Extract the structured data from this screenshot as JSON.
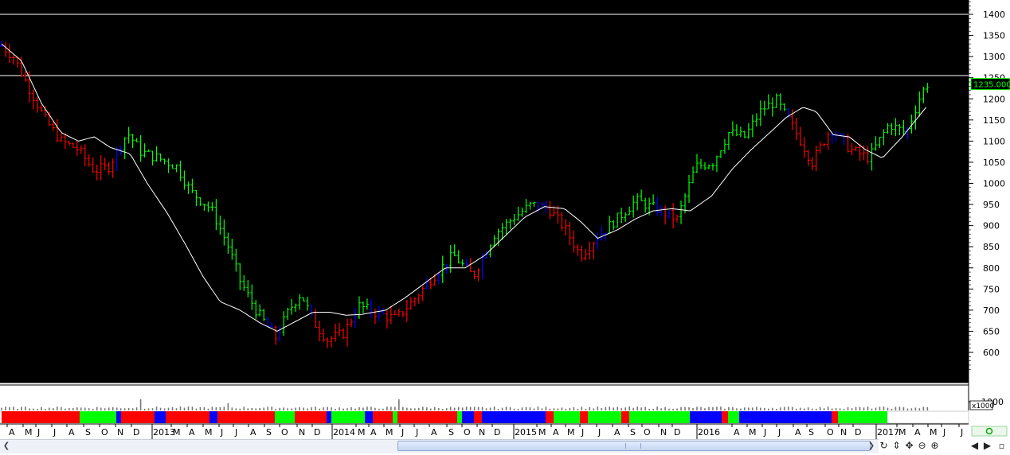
{
  "chart_data": {
    "type": "candlestick-bar",
    "y_ticks": [
      "1400",
      "1350",
      "1300",
      "1250",
      "1200",
      "1150",
      "1100",
      "1050",
      "1000",
      "950",
      "900",
      "850",
      "800",
      "750",
      "700",
      "650",
      "600"
    ],
    "ylim": [
      560,
      1430
    ],
    "last_price_label": "1235.000",
    "horizontal_lines": [
      1400,
      1255
    ],
    "volume_axis": {
      "tick": "1000",
      "multiplier": "x1000"
    },
    "x_labels": [
      "A",
      "M",
      "J",
      "J",
      "A",
      "S",
      "O",
      "N",
      "D",
      "2013",
      "M",
      "A",
      "M",
      "J",
      "J",
      "A",
      "S",
      "O",
      "N",
      "D",
      "2014",
      "M",
      "A",
      "M",
      "J",
      "J",
      "A",
      "S",
      "O",
      "N",
      "D",
      "2015",
      "M",
      "A",
      "M",
      "J",
      "J",
      "A",
      "S",
      "O",
      "N",
      "D",
      "2016",
      "A",
      "M",
      "J",
      "J",
      "A",
      "S",
      "O",
      "N",
      "D",
      "2017",
      "M",
      "A",
      "M",
      "J",
      "J"
    ],
    "price_path_anchors": [
      [
        0,
        1325
      ],
      [
        9,
        1300
      ],
      [
        20,
        1230
      ],
      [
        33,
        1150
      ],
      [
        45,
        1100
      ],
      [
        58,
        1080
      ],
      [
        70,
        1030
      ],
      [
        81,
        1040
      ],
      [
        95,
        1120
      ],
      [
        105,
        1075
      ],
      [
        118,
        1060
      ],
      [
        132,
        1040
      ],
      [
        143,
        980
      ],
      [
        158,
        940
      ],
      [
        170,
        860
      ],
      [
        180,
        770
      ],
      [
        192,
        700
      ],
      [
        207,
        635
      ],
      [
        217,
        700
      ],
      [
        226,
        740
      ],
      [
        236,
        670
      ],
      [
        246,
        630
      ],
      [
        258,
        645
      ],
      [
        270,
        710
      ],
      [
        286,
        690
      ],
      [
        298,
        680
      ],
      [
        310,
        720
      ],
      [
        326,
        780
      ],
      [
        341,
        830
      ],
      [
        356,
        780
      ],
      [
        372,
        880
      ],
      [
        387,
        920
      ],
      [
        400,
        950
      ],
      [
        413,
        940
      ],
      [
        425,
        895
      ],
      [
        437,
        830
      ],
      [
        452,
        880
      ],
      [
        466,
        920
      ],
      [
        479,
        960
      ],
      [
        494,
        940
      ],
      [
        510,
        915
      ],
      [
        524,
        1040
      ],
      [
        537,
        1050
      ],
      [
        549,
        1120
      ],
      [
        561,
        1110
      ],
      [
        574,
        1175
      ],
      [
        585,
        1195
      ],
      [
        598,
        1130
      ],
      [
        612,
        1050
      ],
      [
        626,
        1130
      ],
      [
        641,
        1080
      ],
      [
        655,
        1060
      ],
      [
        670,
        1140
      ],
      [
        683,
        1120
      ],
      [
        694,
        1210
      ],
      [
        700,
        1240
      ]
    ],
    "ma_path_anchors": [
      [
        0,
        1330
      ],
      [
        15,
        1290
      ],
      [
        30,
        1190
      ],
      [
        45,
        1120
      ],
      [
        58,
        1100
      ],
      [
        70,
        1110
      ],
      [
        82,
        1085
      ],
      [
        97,
        1070
      ],
      [
        110,
        1000
      ],
      [
        125,
        930
      ],
      [
        138,
        860
      ],
      [
        152,
        780
      ],
      [
        165,
        720
      ],
      [
        180,
        700
      ],
      [
        195,
        670
      ],
      [
        208,
        650
      ],
      [
        220,
        670
      ],
      [
        235,
        695
      ],
      [
        248,
        695
      ],
      [
        260,
        688
      ],
      [
        272,
        690
      ],
      [
        290,
        700
      ],
      [
        305,
        730
      ],
      [
        320,
        765
      ],
      [
        335,
        800
      ],
      [
        350,
        800
      ],
      [
        365,
        830
      ],
      [
        380,
        875
      ],
      [
        395,
        920
      ],
      [
        410,
        945
      ],
      [
        425,
        940
      ],
      [
        437,
        910
      ],
      [
        450,
        870
      ],
      [
        465,
        890
      ],
      [
        478,
        915
      ],
      [
        492,
        935
      ],
      [
        506,
        940
      ],
      [
        520,
        935
      ],
      [
        536,
        970
      ],
      [
        552,
        1035
      ],
      [
        566,
        1080
      ],
      [
        580,
        1120
      ],
      [
        592,
        1155
      ],
      [
        605,
        1180
      ],
      [
        615,
        1170
      ],
      [
        628,
        1115
      ],
      [
        640,
        1110
      ],
      [
        652,
        1080
      ],
      [
        665,
        1060
      ],
      [
        680,
        1110
      ],
      [
        698,
        1180
      ]
    ],
    "volume_segments": [
      "red",
      "green",
      "blue",
      "red",
      "blue",
      "red",
      "blue",
      "red",
      "green",
      "red",
      "blue",
      "green",
      "blue",
      "red",
      "green",
      "red",
      "green",
      "blue",
      "red",
      "blue",
      "red",
      "green",
      "red",
      "green",
      "red",
      "green",
      "blue",
      "red",
      "green",
      "blue",
      "red",
      "green"
    ],
    "colors": {
      "up": "#00ff00",
      "down": "#ff0000",
      "flat": "#0000ff",
      "ma": "#ffffff",
      "background": "#000000"
    }
  },
  "toolbar": {
    "zoom_in": "⊕",
    "zoom_out": "⊖",
    "move": "✥",
    "pan": "⇕",
    "refresh": "↻",
    "prev": "◀",
    "next": "▶"
  }
}
